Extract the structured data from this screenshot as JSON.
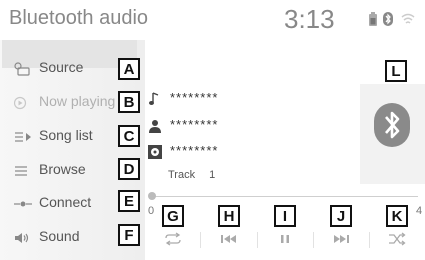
{
  "header": {
    "title": "Bluetooth audio",
    "clock": "3:13"
  },
  "sidebar": {
    "items": [
      {
        "label": "Source",
        "callout": "A",
        "icon": "source-icon"
      },
      {
        "label": "Now playing",
        "callout": "B",
        "icon": "now-playing-icon"
      },
      {
        "label": "Song list",
        "callout": "C",
        "icon": "song-list-icon"
      },
      {
        "label": "Browse",
        "callout": "D",
        "icon": "browse-icon"
      },
      {
        "label": "Connect",
        "callout": "E",
        "icon": "connect-icon"
      },
      {
        "label": "Sound",
        "callout": "F",
        "icon": "sound-icon"
      }
    ]
  },
  "info": {
    "song": "********",
    "artist": "********",
    "album": "********",
    "track_label": "Track",
    "track_number": "1"
  },
  "progress": {
    "time_start": "0",
    "time_end": "4",
    "fraction": 0
  },
  "controls": {
    "callouts": [
      "G",
      "H",
      "I",
      "J",
      "K"
    ],
    "icons": [
      "repeat-icon",
      "previous-track-icon",
      "pause-icon",
      "next-track-icon",
      "shuffle-icon"
    ]
  },
  "album_art": {
    "callout": "L",
    "icon": "bluetooth-icon"
  },
  "colors": {
    "text": "#555555",
    "dim_text": "#b0b0b0",
    "icon_gray": "#9a9a9a",
    "art_gray": "#8a8a8a"
  }
}
